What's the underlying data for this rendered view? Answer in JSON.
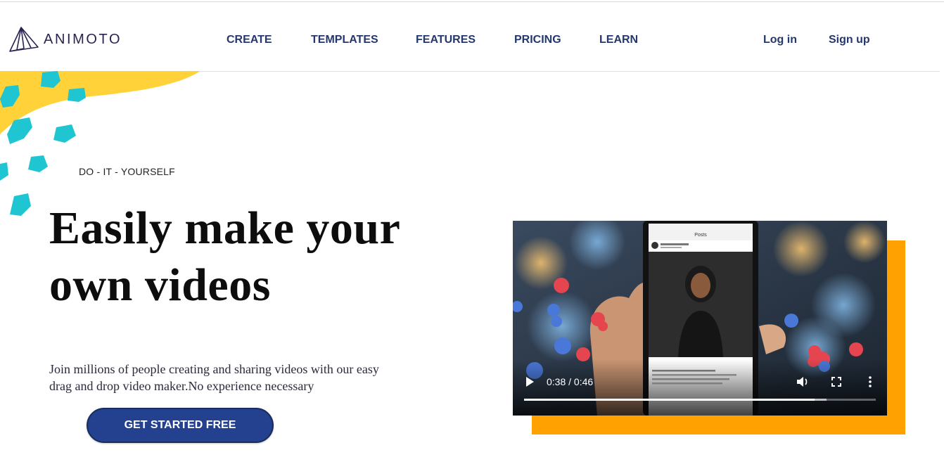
{
  "brand": {
    "name": "ANIMOTO"
  },
  "nav": {
    "items": [
      "CREATE",
      "TEMPLATES",
      "FEATURES",
      "PRICING",
      "LEARN"
    ],
    "login": "Log in",
    "signup": "Sign up"
  },
  "hero": {
    "eyebrow": "DO - IT - YOURSELF",
    "headline_line1": "Easily make your",
    "headline_line2": "own videos",
    "subtext_line1": "Join millions of people creating and sharing videos with our easy",
    "subtext_line2": "drag and drop video maker.No experience necessary",
    "cta": "GET STARTED FREE"
  },
  "video": {
    "time": "0:38 / 0:46",
    "progress": 0.826,
    "buffered": 0.86,
    "phone_header": "Posts",
    "icons": [
      "play-icon",
      "volume-icon",
      "fullscreen-icon",
      "more-vertical-icon"
    ]
  },
  "colors": {
    "nav_text": "#24386f",
    "cta_bg": "#23418f",
    "accent_yellow": "#ffd23a",
    "accent_teal": "#1fc6d2",
    "video_backdrop": "#ffa100"
  }
}
